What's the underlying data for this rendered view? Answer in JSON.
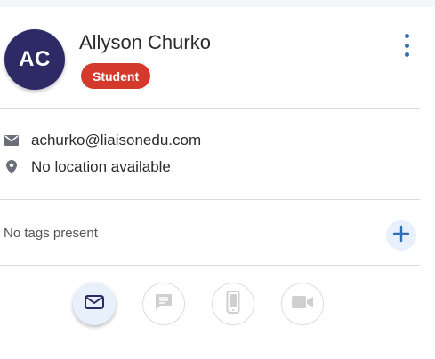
{
  "contact": {
    "initials": "AC",
    "name": "Allyson Churko",
    "role_badge": "Student",
    "email": "achurko@liaisonedu.com",
    "location": "No location available"
  },
  "tags": {
    "empty_text": "No tags present"
  },
  "icons": {
    "menu": "more-vertical-icon",
    "email_row": "envelope-icon",
    "location_row": "map-pin-icon",
    "add_tag": "plus-icon",
    "actions": [
      "email-icon",
      "chat-icon",
      "phone-icon",
      "video-icon"
    ]
  },
  "colors": {
    "avatar_bg": "#2d2a66",
    "badge_bg": "#d33a2c",
    "accent": "#2f6fb8",
    "disabled_icon": "#cfcfcf"
  }
}
